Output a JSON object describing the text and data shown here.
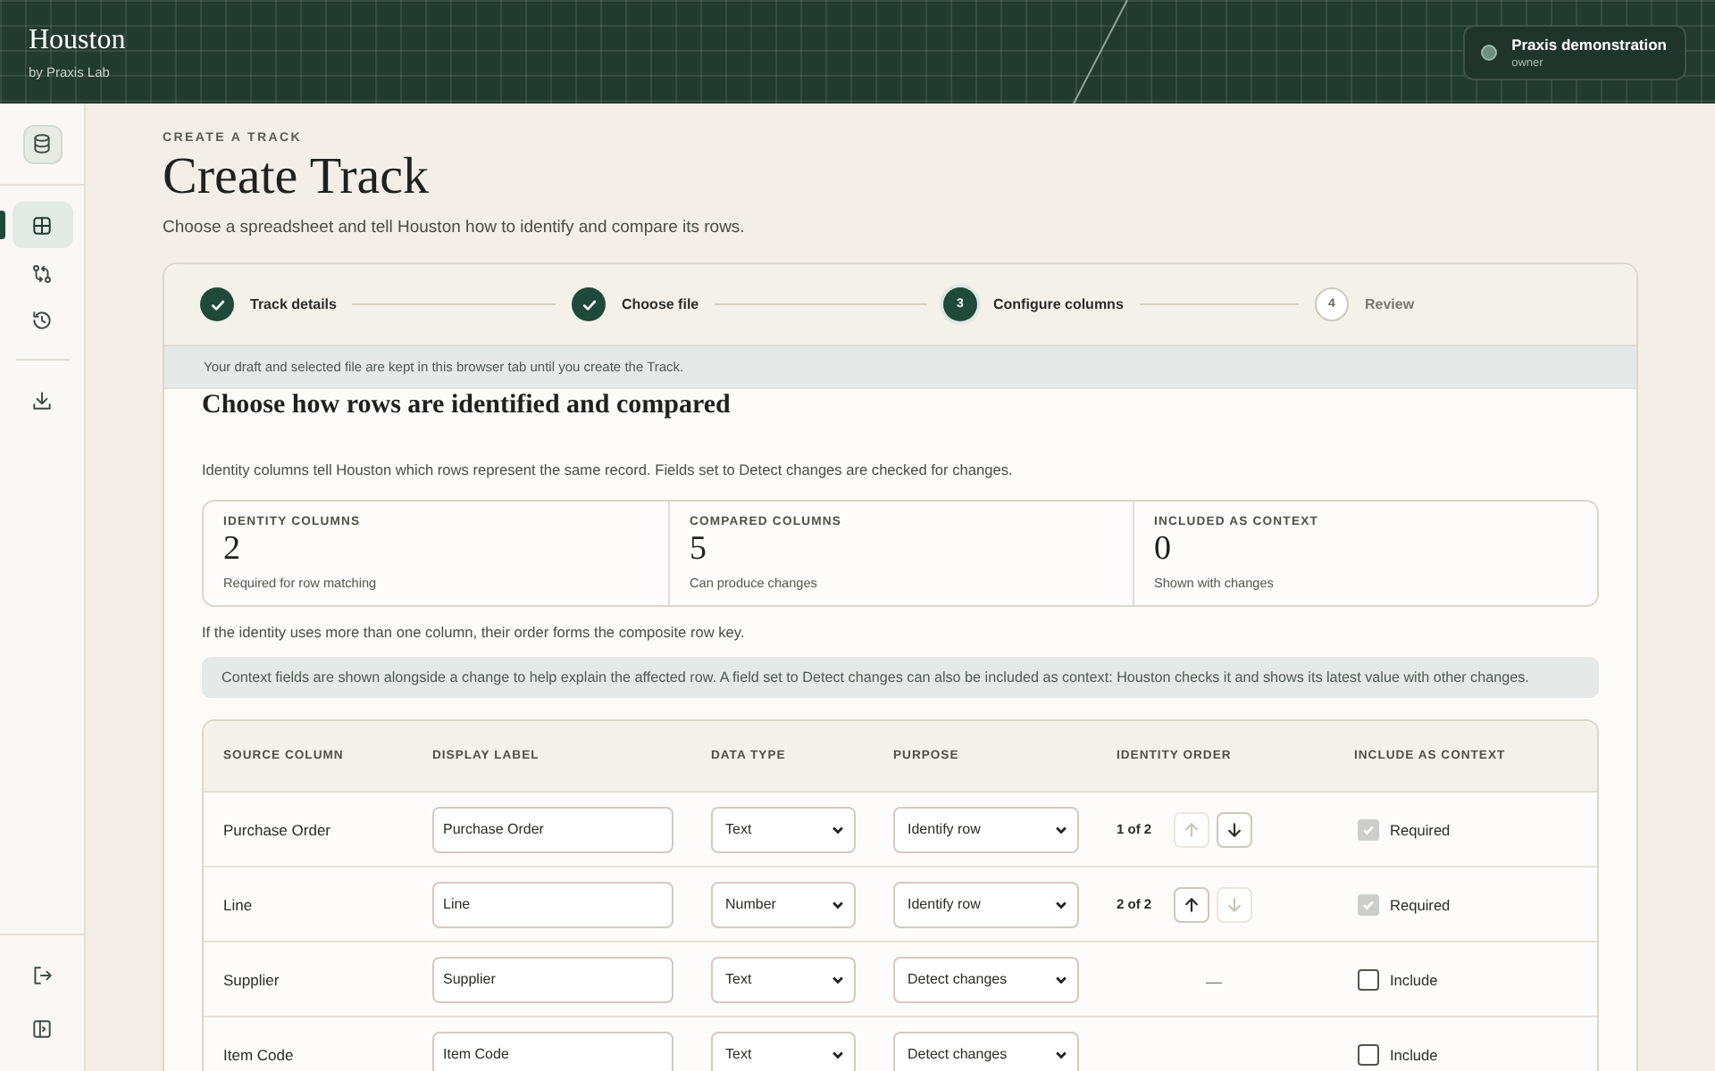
{
  "app": {
    "name": "Houston",
    "byline": "by Praxis Lab"
  },
  "account": {
    "name": "Praxis demonstration",
    "role": "owner"
  },
  "sidebar": {
    "top": {
      "kind": "database",
      "selected": false
    },
    "items": [
      {
        "kind": "grid",
        "selected": true
      },
      {
        "kind": "compare",
        "selected": false
      },
      {
        "kind": "history",
        "selected": false
      }
    ],
    "tools": [
      {
        "kind": "download",
        "selected": false
      }
    ],
    "bottom": [
      {
        "kind": "logout",
        "selected": false
      },
      {
        "kind": "panel",
        "selected": false
      }
    ]
  },
  "page": {
    "eyebrow": "CREATE A TRACK",
    "title": "Create Track",
    "subtitle": "Choose a spreadsheet and tell Houston how to identify and compare its rows."
  },
  "steps": [
    {
      "label": "Track details",
      "completed": true,
      "selected": false
    },
    {
      "label": "Choose file",
      "completed": true,
      "selected": false
    },
    {
      "label": "Configure columns",
      "completed": false,
      "selected": true,
      "number": "3"
    },
    {
      "label": "Review",
      "completed": false,
      "selected": false,
      "number": "4"
    }
  ],
  "notice": "Your draft and selected file are kept in this browser tab until you create the Track.",
  "section": {
    "title": "Choose how rows are identified and compared",
    "intro": "Identity columns tell Houston which rows represent the same record. Fields set to Detect changes are checked for changes."
  },
  "stats": [
    {
      "label": "IDENTITY COLUMNS",
      "value": "2",
      "caption": "Required for row matching"
    },
    {
      "label": "COMPARED COLUMNS",
      "value": "5",
      "caption": "Can produce changes"
    },
    {
      "label": "INCLUDED AS CONTEXT",
      "value": "0",
      "caption": "Shown with changes"
    }
  ],
  "composite_note": "If the identity uses more than one column, their order forms the composite row key.",
  "context_note": "Context fields are shown alongside a change to help explain the affected row. A field set to Detect changes can also be included as context: Houston checks it and shows its latest value with other changes.",
  "table": {
    "columns": [
      "SOURCE COLUMN",
      "DISPLAY LABEL",
      "DATA TYPE",
      "PURPOSE",
      "IDENTITY ORDER",
      "INCLUDE AS CONTEXT"
    ],
    "rows": [
      {
        "source": "Purchase Order",
        "label": "Purchase Order",
        "data_type": "Text",
        "purpose": "Identify row",
        "order": "1 of 2",
        "up_disabled": true,
        "down_disabled": false,
        "context_checked": true,
        "context_disabled": true,
        "context_label": "Required"
      },
      {
        "source": "Line",
        "label": "Line",
        "data_type": "Number",
        "purpose": "Identify row",
        "order": "2 of 2",
        "up_disabled": false,
        "down_disabled": true,
        "context_checked": true,
        "context_disabled": true,
        "context_label": "Required"
      },
      {
        "source": "Supplier",
        "label": "Supplier",
        "data_type": "Text",
        "purpose": "Detect changes",
        "order_placeholder": "—",
        "context_checked": false,
        "context_disabled": false,
        "context_label": "Include"
      },
      {
        "source": "Item Code",
        "label": "Item Code",
        "data_type": "Text",
        "purpose": "Detect changes",
        "context_checked": false,
        "context_disabled": false,
        "context_label": "Include"
      }
    ]
  }
}
